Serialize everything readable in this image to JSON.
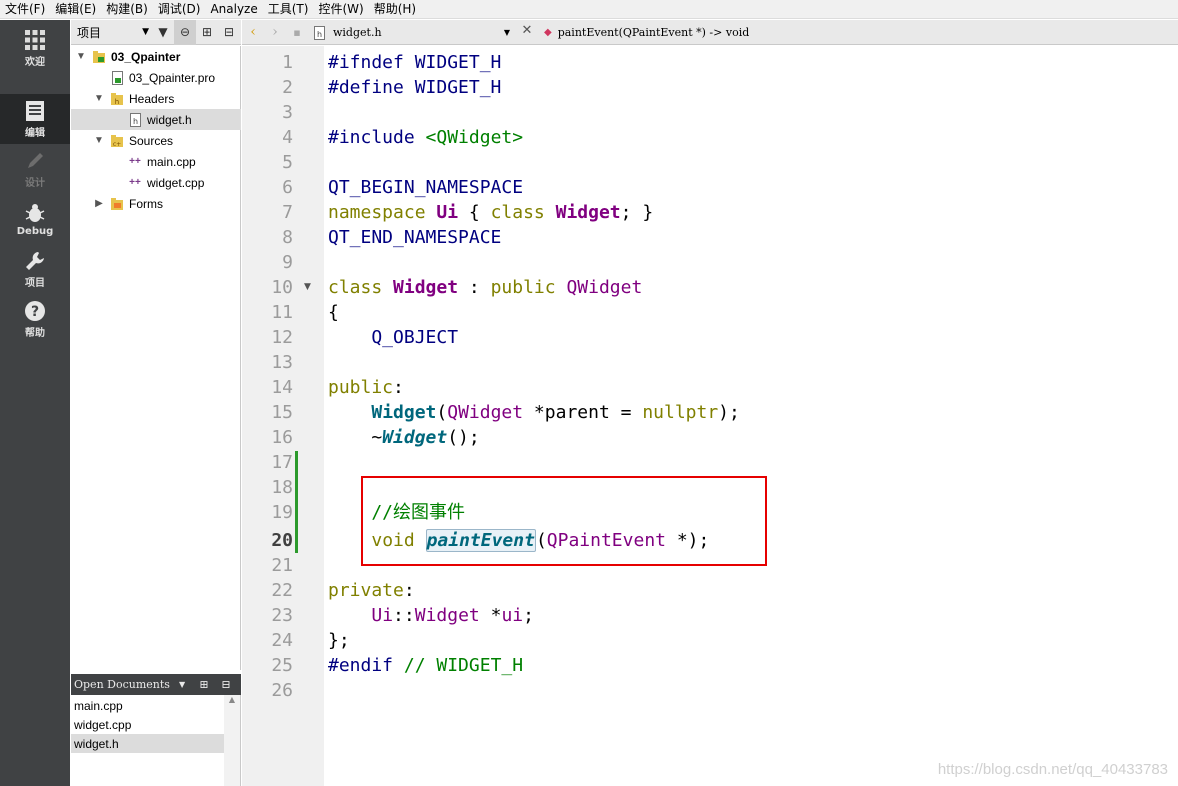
{
  "menubar": {
    "items": [
      "文件(F)",
      "编辑(E)",
      "构建(B)",
      "调试(D)",
      "Analyze",
      "工具(T)",
      "控件(W)",
      "帮助(H)"
    ]
  },
  "modes": [
    {
      "label": "欢迎",
      "icon": "grid-icon",
      "active": false
    },
    {
      "label": "编辑",
      "icon": "edit-document-icon",
      "active": true
    },
    {
      "label": "设计",
      "icon": "pencil-icon",
      "active": false,
      "disabled": true
    },
    {
      "label": "Debug",
      "icon": "bug-icon",
      "active": false
    },
    {
      "label": "项目",
      "icon": "wrench-icon",
      "active": false
    },
    {
      "label": "帮助",
      "icon": "help-icon",
      "active": false
    }
  ],
  "project_panel": {
    "view_label": "项目",
    "tree": [
      {
        "label": "03_Qpainter",
        "icon": "project-icon",
        "arrow": "▼",
        "bold": true
      },
      {
        "label": "03_Qpainter.pro",
        "icon": "pro-file-icon",
        "arrow": ""
      },
      {
        "label": "Headers",
        "icon": "header-folder-icon",
        "arrow": "▼"
      },
      {
        "label": "widget.h",
        "icon": "header-file-icon",
        "arrow": "",
        "selected": true
      },
      {
        "label": "Sources",
        "icon": "source-folder-icon",
        "arrow": "▼"
      },
      {
        "label": "main.cpp",
        "icon": "cpp-file-icon",
        "arrow": ""
      },
      {
        "label": "widget.cpp",
        "icon": "cpp-file-icon",
        "arrow": ""
      },
      {
        "label": "Forms",
        "icon": "forms-folder-icon",
        "arrow": "▶"
      }
    ]
  },
  "open_documents": {
    "title": "Open Documents",
    "items": [
      {
        "label": "main.cpp",
        "selected": false
      },
      {
        "label": "widget.cpp",
        "selected": false
      },
      {
        "label": "widget.h",
        "selected": true
      }
    ]
  },
  "editor_toolbar": {
    "file": "widget.h",
    "symbol": "paintEvent(QPaintEvent *) -> void"
  },
  "editor": {
    "current_line": 20,
    "line_numbers": [
      "1",
      "2",
      "3",
      "4",
      "5",
      "6",
      "7",
      "8",
      "9",
      "10",
      "11",
      "12",
      "13",
      "14",
      "15",
      "16",
      "17",
      "18",
      "19",
      "20",
      "21",
      "22",
      "23",
      "24",
      "25",
      "26"
    ],
    "lines": {
      "l1": {
        "a": "#ifndef WIDGET_H"
      },
      "l2": {
        "a": "#define WIDGET_H"
      },
      "l4": {
        "a": "#include ",
        "b": "<QWidget>"
      },
      "l6": {
        "a": "QT_BEGIN_NAMESPACE"
      },
      "l7": {
        "a": "namespace ",
        "b": "Ui",
        "c": " { ",
        "d": "class ",
        "e": "Widget",
        "f": "; }"
      },
      "l8": {
        "a": "QT_END_NAMESPACE"
      },
      "l10": {
        "a": "class ",
        "b": "Widget",
        "c": " : ",
        "d": "public ",
        "e": "QWidget"
      },
      "l11": {
        "a": "{"
      },
      "l12": {
        "a": "    Q_OBJECT"
      },
      "l14": {
        "a": "public",
        "b": ":"
      },
      "l15": {
        "a": "    ",
        "b": "Widget",
        "c": "(",
        "d": "QWidget",
        "e": " *parent = ",
        "f": "nullptr",
        "g": ");"
      },
      "l16": {
        "a": "    ~",
        "b": "Widget",
        "c": "();"
      },
      "l19": {
        "a": "    //绘图事件"
      },
      "l20": {
        "a": "    ",
        "b": "void",
        "c": " ",
        "d": "paintEvent",
        "e": "(",
        "f": "QPaintEvent",
        "g": " *);"
      },
      "l22": {
        "a": "private",
        "b": ":"
      },
      "l23": {
        "a": "    ",
        "b": "Ui",
        "c": "::",
        "d": "Widget",
        "e": " *",
        "f": "ui",
        "g": ";"
      },
      "l24": {
        "a": "};"
      },
      "l25": {
        "a": "#endif",
        "b": " // WIDGET_H"
      }
    }
  },
  "watermark": "https://blog.csdn.net/qq_40433783"
}
